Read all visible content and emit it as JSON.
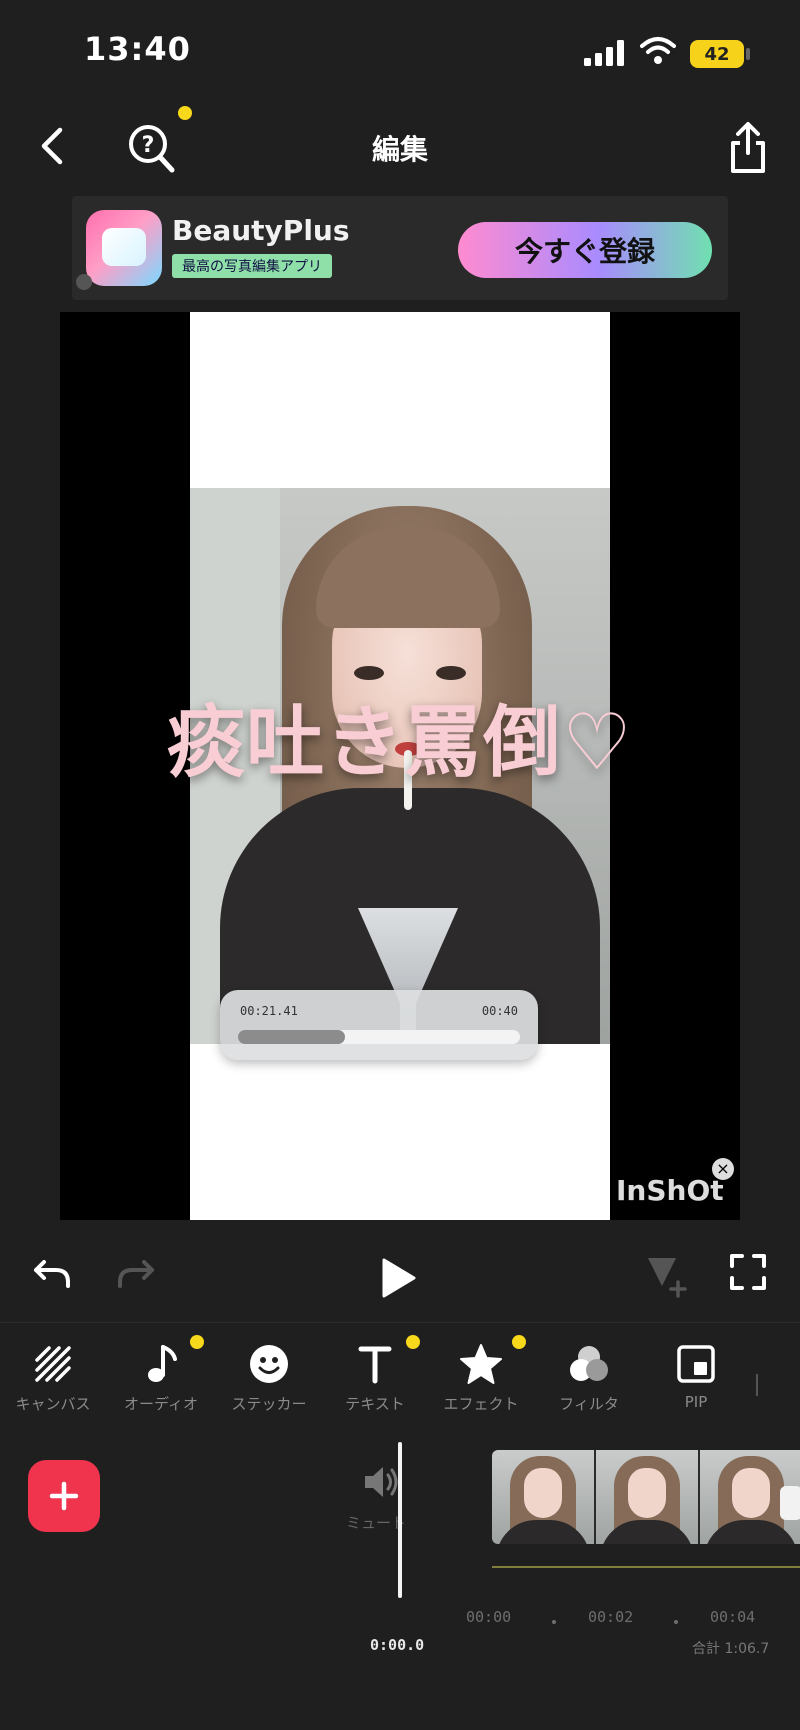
{
  "status_bar": {
    "time": "13:40",
    "battery": "42"
  },
  "header": {
    "title": "編集"
  },
  "ad": {
    "app_name": "BeautyPlus",
    "tagline": "最高の写真編集アプリ",
    "cta": "今すぐ登録"
  },
  "preview": {
    "overlay_text": "痰吐き罵倒♡",
    "player": {
      "elapsed": "00:21.41",
      "duration": "00:40",
      "progress": 0.38
    },
    "watermark": "InShOt"
  },
  "toolbar": {
    "items": [
      {
        "label": "キャンバス",
        "icon": "canvas-icon",
        "badge": false
      },
      {
        "label": "オーディオ",
        "icon": "music-note-icon",
        "badge": true
      },
      {
        "label": "ステッカー",
        "icon": "sticker-smiley-icon",
        "badge": false
      },
      {
        "label": "テキスト",
        "icon": "text-icon",
        "badge": true
      },
      {
        "label": "エフェクト",
        "icon": "star-icon",
        "badge": true
      },
      {
        "label": "フィルタ",
        "icon": "filter-icon",
        "badge": false
      },
      {
        "label": "PIP",
        "icon": "pip-icon",
        "badge": false
      }
    ]
  },
  "timeline": {
    "mute_label": "ミュート",
    "ruler": [
      "00:00",
      "00:02",
      "00:04"
    ],
    "current_time": "0:00.0",
    "total": "合計 1:06.7"
  },
  "colors": {
    "accent_yellow": "#f8d81a",
    "add_button": "#f0344e",
    "overlay_text": "#f9cdd4"
  }
}
